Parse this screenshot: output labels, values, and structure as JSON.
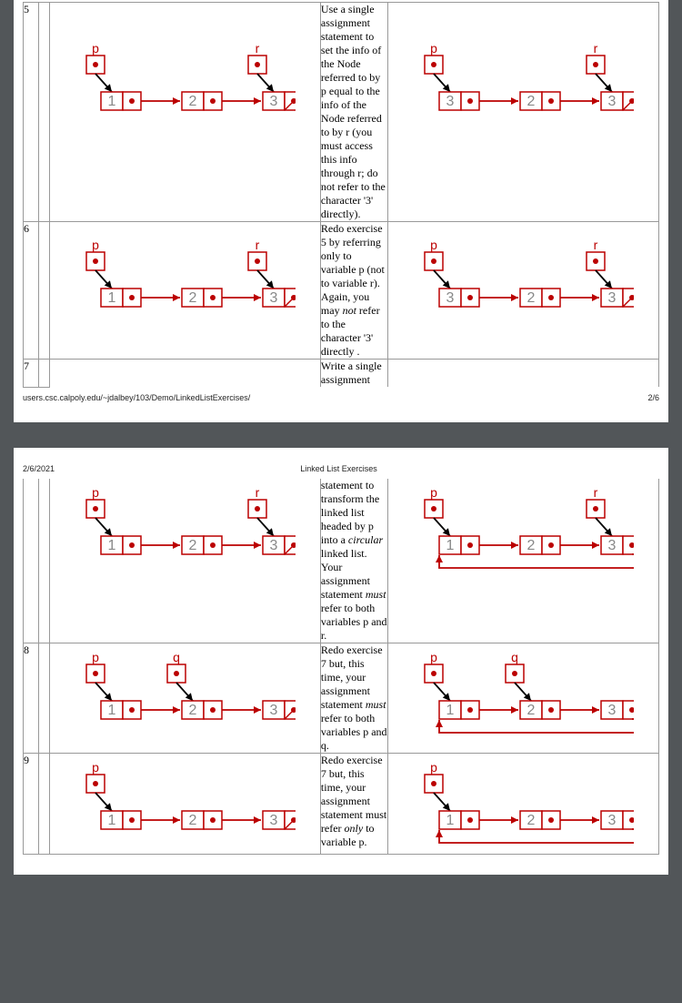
{
  "meta": {
    "url": "users.csc.calpoly.edu/~jdalbey/103/Demo/LinkedListExercises/",
    "page_right": "2/6",
    "date": "2/6/2021",
    "title": "Linked List Exercises"
  },
  "rows": {
    "r5": {
      "num": "5",
      "text": "Use a single assignment statement to set the info of the Node referred to by p equal to the info of the Node referred to by r (you must access this info through r; do not refer to the character '3' directly).",
      "before": {
        "vals": [
          "1",
          "2",
          "3"
        ],
        "ptrs": [
          {
            "lbl": "p",
            "idx": 0
          },
          {
            "lbl": "r",
            "idx": 2
          }
        ],
        "tail_null": true
      },
      "after": {
        "vals": [
          "3",
          "2",
          "3"
        ],
        "ptrs": [
          {
            "lbl": "p",
            "idx": 0
          },
          {
            "lbl": "r",
            "idx": 2
          }
        ],
        "tail_null": true
      }
    },
    "r6": {
      "num": "6",
      "text_pre": "Redo exercise 5 by referring only to variable p (not to variable r). Again, you may ",
      "text_em": "not",
      "text_post": " refer to the character '3' directly .",
      "before": {
        "vals": [
          "1",
          "2",
          "3"
        ],
        "ptrs": [
          {
            "lbl": "p",
            "idx": 0
          },
          {
            "lbl": "r",
            "idx": 2
          }
        ],
        "tail_null": true
      },
      "after": {
        "vals": [
          "3",
          "2",
          "3"
        ],
        "ptrs": [
          {
            "lbl": "p",
            "idx": 0
          },
          {
            "lbl": "r",
            "idx": 2
          }
        ],
        "tail_null": true
      }
    },
    "r7half": {
      "num": "7",
      "text": "Write a single assignment"
    },
    "r7rest": {
      "text_pre": "statement to transform the linked list headed by p into a ",
      "text_em": "circular",
      "text_mid": " linked list. Your assignment statement ",
      "text_em2": "must",
      "text_post": " refer to both variables p and r.",
      "before": {
        "vals": [
          "1",
          "2",
          "3"
        ],
        "ptrs": [
          {
            "lbl": "p",
            "idx": 0
          },
          {
            "lbl": "r",
            "idx": 2
          }
        ],
        "tail_null": true
      },
      "after": {
        "vals": [
          "1",
          "2",
          "3"
        ],
        "ptrs": [
          {
            "lbl": "p",
            "idx": 0
          },
          {
            "lbl": "r",
            "idx": 2
          }
        ],
        "circular": true
      }
    },
    "r8": {
      "num": "8",
      "text_pre": "Redo exercise 7 but, this time, your assignment statement ",
      "text_em": "must",
      "text_post": " refer to both variables p and q.",
      "before": {
        "vals": [
          "1",
          "2",
          "3"
        ],
        "ptrs": [
          {
            "lbl": "p",
            "idx": 0
          },
          {
            "lbl": "q",
            "idx": 1
          }
        ],
        "tail_null": true
      },
      "after": {
        "vals": [
          "1",
          "2",
          "3"
        ],
        "ptrs": [
          {
            "lbl": "p",
            "idx": 0
          },
          {
            "lbl": "q",
            "idx": 1
          }
        ],
        "circular": true
      }
    },
    "r9": {
      "num": "9",
      "text_pre": "Redo exercise 7 but, this time, your assignment statement must refer ",
      "text_em": "only",
      "text_post": " to variable p.",
      "before": {
        "vals": [
          "1",
          "2",
          "3"
        ],
        "ptrs": [
          {
            "lbl": "p",
            "idx": 0
          }
        ],
        "tail_null": true
      },
      "after": {
        "vals": [
          "1",
          "2",
          "3"
        ],
        "ptrs": [
          {
            "lbl": "p",
            "idx": 0
          }
        ],
        "circular": true
      }
    }
  },
  "chart_data": null
}
